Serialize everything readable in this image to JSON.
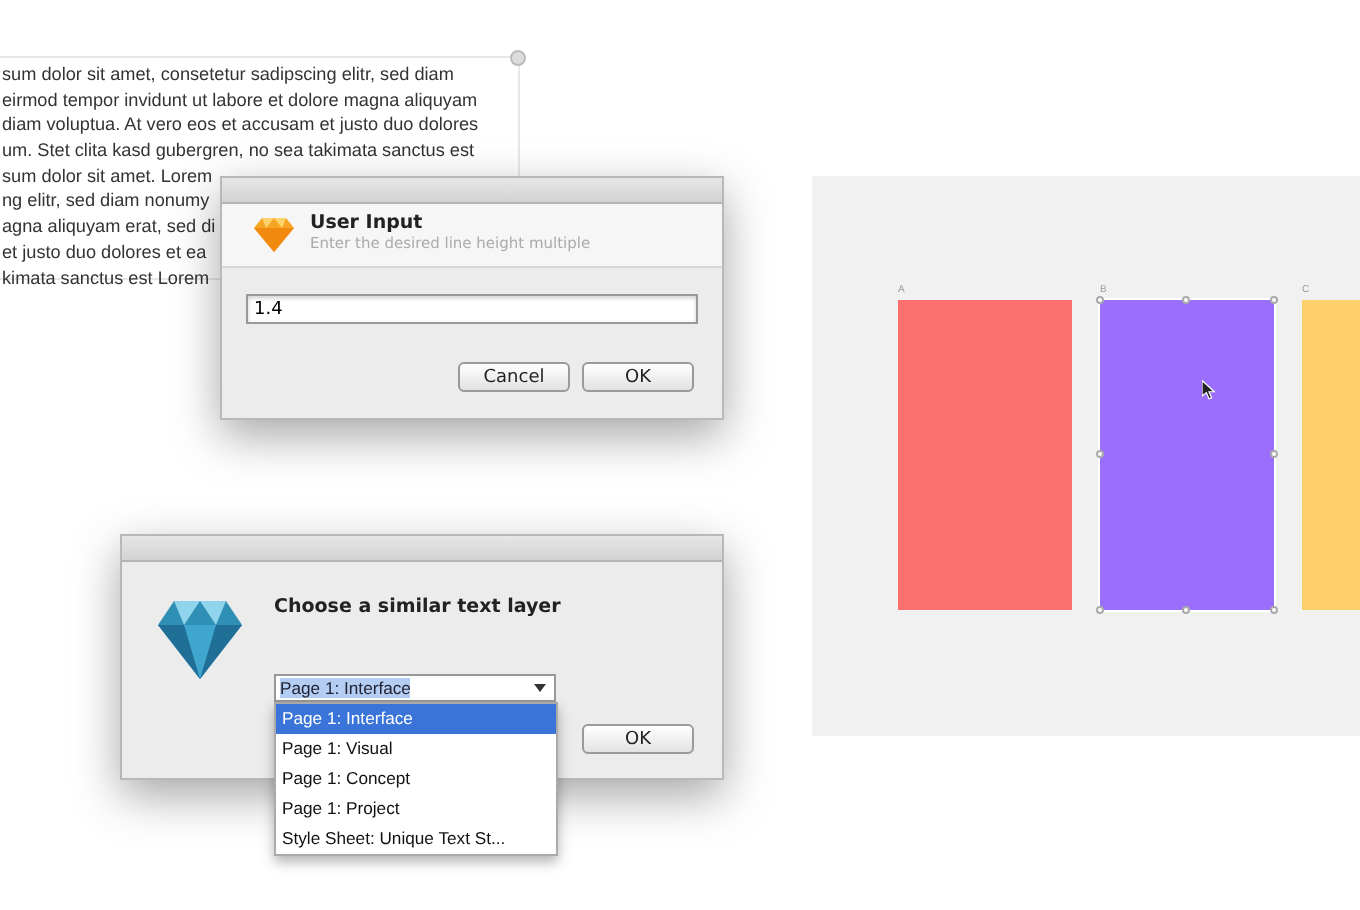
{
  "text_layer": {
    "lines": [
      "sum dolor sit amet, consetetur sadipscing elitr, sed diam",
      "eirmod tempor invidunt ut labore et dolore magna aliquyam",
      "diam voluptua. At vero eos et accusam et justo duo dolores",
      "um. Stet clita kasd gubergren, no sea takimata sanctus est",
      "sum dolor sit amet. Lorem",
      "ng elitr, sed diam nonumy",
      "agna aliquyam erat, sed di",
      "et justo duo dolores et ea",
      "kimata sanctus est Lorem"
    ]
  },
  "user_input_dialog": {
    "title": "User Input",
    "subtitle": "Enter the desired line height multiple",
    "value": "1.4",
    "buttons": [
      {
        "label": "Cancel",
        "kind": "normal"
      },
      {
        "label": "OK",
        "kind": "normal"
      }
    ]
  },
  "layer_dialog": {
    "heading": "Choose a similar text layer",
    "select": {
      "value": "Page 1: Interface",
      "expanded": true
    },
    "options": [
      {
        "label": "Page 1: Interface",
        "selected": true
      },
      {
        "label": "Page 1: Visual",
        "selected": false
      },
      {
        "label": "Page 1: Concept",
        "selected": false
      },
      {
        "label": "Page 1: Project",
        "selected": false
      },
      {
        "label": "Style Sheet: Unique Text St...",
        "selected": false
      }
    ],
    "button": "OK"
  },
  "canvas": {
    "artboards": [
      {
        "label": "A",
        "color": "#fd7070",
        "selected": false
      },
      {
        "label": "B",
        "color": "#9b6efc",
        "selected": true
      },
      {
        "label": "C",
        "color": "#fdd06b",
        "selected": false
      }
    ]
  }
}
